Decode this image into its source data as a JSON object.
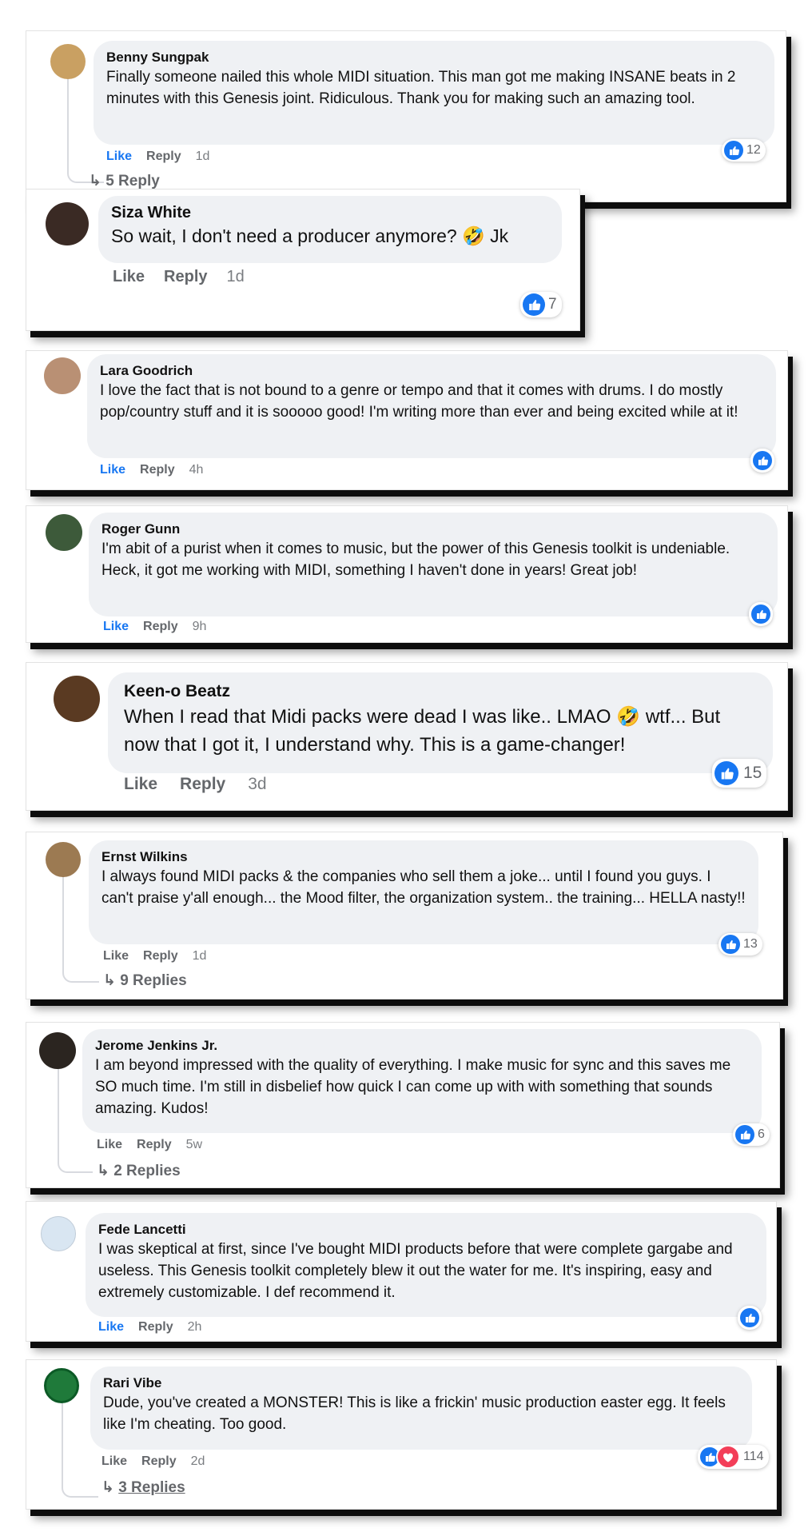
{
  "comments": [
    {
      "name": "Benny Sungpak",
      "text": "Finally someone nailed this whole MIDI situation. This man got me making INSANE beats in 2 minutes with this Genesis joint. Ridiculous. Thank you for making such an amazing tool.",
      "like": "Like",
      "reply": "Reply",
      "time": "1d",
      "count": "12",
      "replies": "5 Reply",
      "avatar_color": "#c9a062"
    },
    {
      "name": "Siza White",
      "text": "So wait, I don't need a producer anymore? 🤣 Jk",
      "like": "Like",
      "reply": "Reply",
      "time": "1d",
      "count": "7",
      "replies": "",
      "avatar_color": "#3a2a24"
    },
    {
      "name": "Lara Goodrich",
      "text": "I love the fact that is not bound to a genre or tempo and that it comes with drums. I do mostly pop/country stuff and it is sooooo good! I'm writing more than ever and being excited while at it!",
      "like": "Like",
      "reply": "Reply",
      "time": "4h",
      "count": "",
      "replies": "",
      "avatar_color": "#b99074"
    },
    {
      "name": "Roger Gunn",
      "text": "I'm abit of a purist when it comes to music, but the power of this Genesis toolkit is undeniable. Heck, it got me working with MIDI, something I haven't done in years! Great job!",
      "like": "Like",
      "reply": "Reply",
      "time": "9h",
      "count": "",
      "replies": "",
      "avatar_color": "#3d5a3a"
    },
    {
      "name": "Keen-o Beatz",
      "text": "When I read that Midi packs were dead I was like.. LMAO 🤣 wtf... But now that I got it, I understand why. This is a game-changer!",
      "like": "Like",
      "reply": "Reply",
      "time": "3d",
      "count": "15",
      "replies": "",
      "avatar_color": "#5a3a22"
    },
    {
      "name": "Ernst Wilkins",
      "text": "I always found MIDI packs & the companies who sell them a joke... until I found you guys. I can't praise y'all enough... the Mood filter, the organization system.. the training... HELLA nasty!!",
      "like": "Like",
      "reply": "Reply",
      "time": "1d",
      "count": "13",
      "replies": "9 Replies",
      "avatar_color": "#9c7a52"
    },
    {
      "name": "Jerome Jenkins Jr.",
      "text": "I am beyond impressed with the quality of everything. I make music for sync and this saves me SO much time. I'm still in disbelief how quick I can come up with with something that sounds amazing. Kudos!",
      "like": "Like",
      "reply": "Reply",
      "time": "5w",
      "count": "6",
      "replies": "2 Replies",
      "avatar_color": "#2b2520"
    },
    {
      "name": "Fede Lancetti",
      "text": "I was skeptical at first, since I've bought MIDI products before that were complete gargabe and useless. This Genesis toolkit completely blew it out the water for me. It's inspiring, easy and extremely customizable. I def recommend it.",
      "like": "Like",
      "reply": "Reply",
      "time": "2h",
      "count": "",
      "replies": "",
      "avatar_color": "#d9e6f2"
    },
    {
      "name": "Rari Vibe",
      "text": "Dude, you've created a MONSTER! This is like a frickin' music production easter egg. It feels like I'm cheating. Too good.",
      "like": "Like",
      "reply": "Reply",
      "time": "2d",
      "count": "114",
      "replies": "3 Replies",
      "avatar_color": "#1f7a3a"
    }
  ]
}
